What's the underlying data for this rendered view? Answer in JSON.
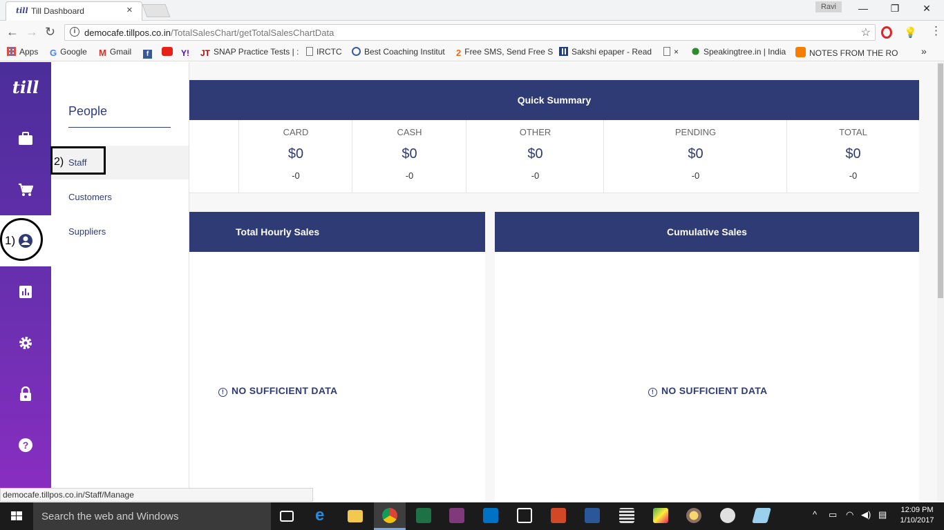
{
  "browser": {
    "tab_title": "Till Dashboard",
    "tab_favicon_text": "till",
    "tab_close": "×",
    "profile_name": "Ravi",
    "window_controls": {
      "minimize": "—",
      "restore": "❐",
      "close": "✕"
    },
    "url_host": "democafe.tillpos.co.in",
    "url_path": "/TotalSalesChart/getTotalSalesChartData",
    "bookmarks": [
      {
        "label": "Apps",
        "icon": "apps-grid-icon"
      },
      {
        "label": "Google",
        "icon": "google-icon"
      },
      {
        "label": "Gmail",
        "icon": "gmail-icon"
      },
      {
        "label": "",
        "icon": "facebook-icon"
      },
      {
        "label": "",
        "icon": "youtube-icon"
      },
      {
        "label": "",
        "icon": "yahoo-icon"
      },
      {
        "label": "SNAP Practice Tests | :",
        "icon": "jt-icon"
      },
      {
        "label": "IRCTC",
        "icon": "page-icon"
      },
      {
        "label": "Best Coaching Institut",
        "icon": "globe-icon"
      },
      {
        "label": "Free SMS, Send Free S",
        "icon": "way2sms-icon"
      },
      {
        "label": "Sakshi epaper - Read",
        "icon": "sakshi-icon"
      },
      {
        "label": "×",
        "icon": "page-icon"
      },
      {
        "label": "Speakingtree.in | India",
        "icon": "tree-icon"
      },
      {
        "label": "NOTES FROM THE RO",
        "icon": "blogger-icon"
      }
    ],
    "bookmarks_overflow": "»",
    "status_url": "democafe.tillpos.co.in/Staff/Manage"
  },
  "sidebar": {
    "logo": "till",
    "items": [
      {
        "icon": "briefcase-icon"
      },
      {
        "icon": "cart-icon"
      },
      {
        "icon": "person-circle-icon",
        "active": true
      },
      {
        "icon": "bar-chart-icon"
      },
      {
        "icon": "gear-icon"
      },
      {
        "icon": "lock-icon"
      },
      {
        "icon": "help-icon"
      }
    ]
  },
  "annotations": {
    "marker1": "1)",
    "marker2": "2)"
  },
  "subnav": {
    "title": "People",
    "items": [
      "Staff",
      "Customers",
      "Suppliers"
    ]
  },
  "quick_summary": {
    "title": "Quick Summary",
    "columns": [
      {
        "label": "CARD",
        "amount": "$0",
        "count": "-0"
      },
      {
        "label": "CASH",
        "amount": "$0",
        "count": "-0"
      },
      {
        "label": "OTHER",
        "amount": "$0",
        "count": "-0"
      },
      {
        "label": "PENDING",
        "amount": "$0",
        "count": "-0"
      },
      {
        "label": "TOTAL",
        "amount": "$0",
        "count": "-0"
      }
    ]
  },
  "panels": {
    "hourly": {
      "title": "Total Hourly Sales",
      "empty": "NO SUFFICIENT DATA"
    },
    "cumulative": {
      "title": "Cumulative Sales",
      "empty": "NO SUFFICIENT DATA"
    }
  },
  "taskbar": {
    "search_placeholder": "Search the web and Windows",
    "time": "12:09 PM",
    "date": "1/10/2017"
  },
  "colors": {
    "brand_navy": "#2e3b75",
    "sidebar_purple": "#6a2fb0"
  }
}
